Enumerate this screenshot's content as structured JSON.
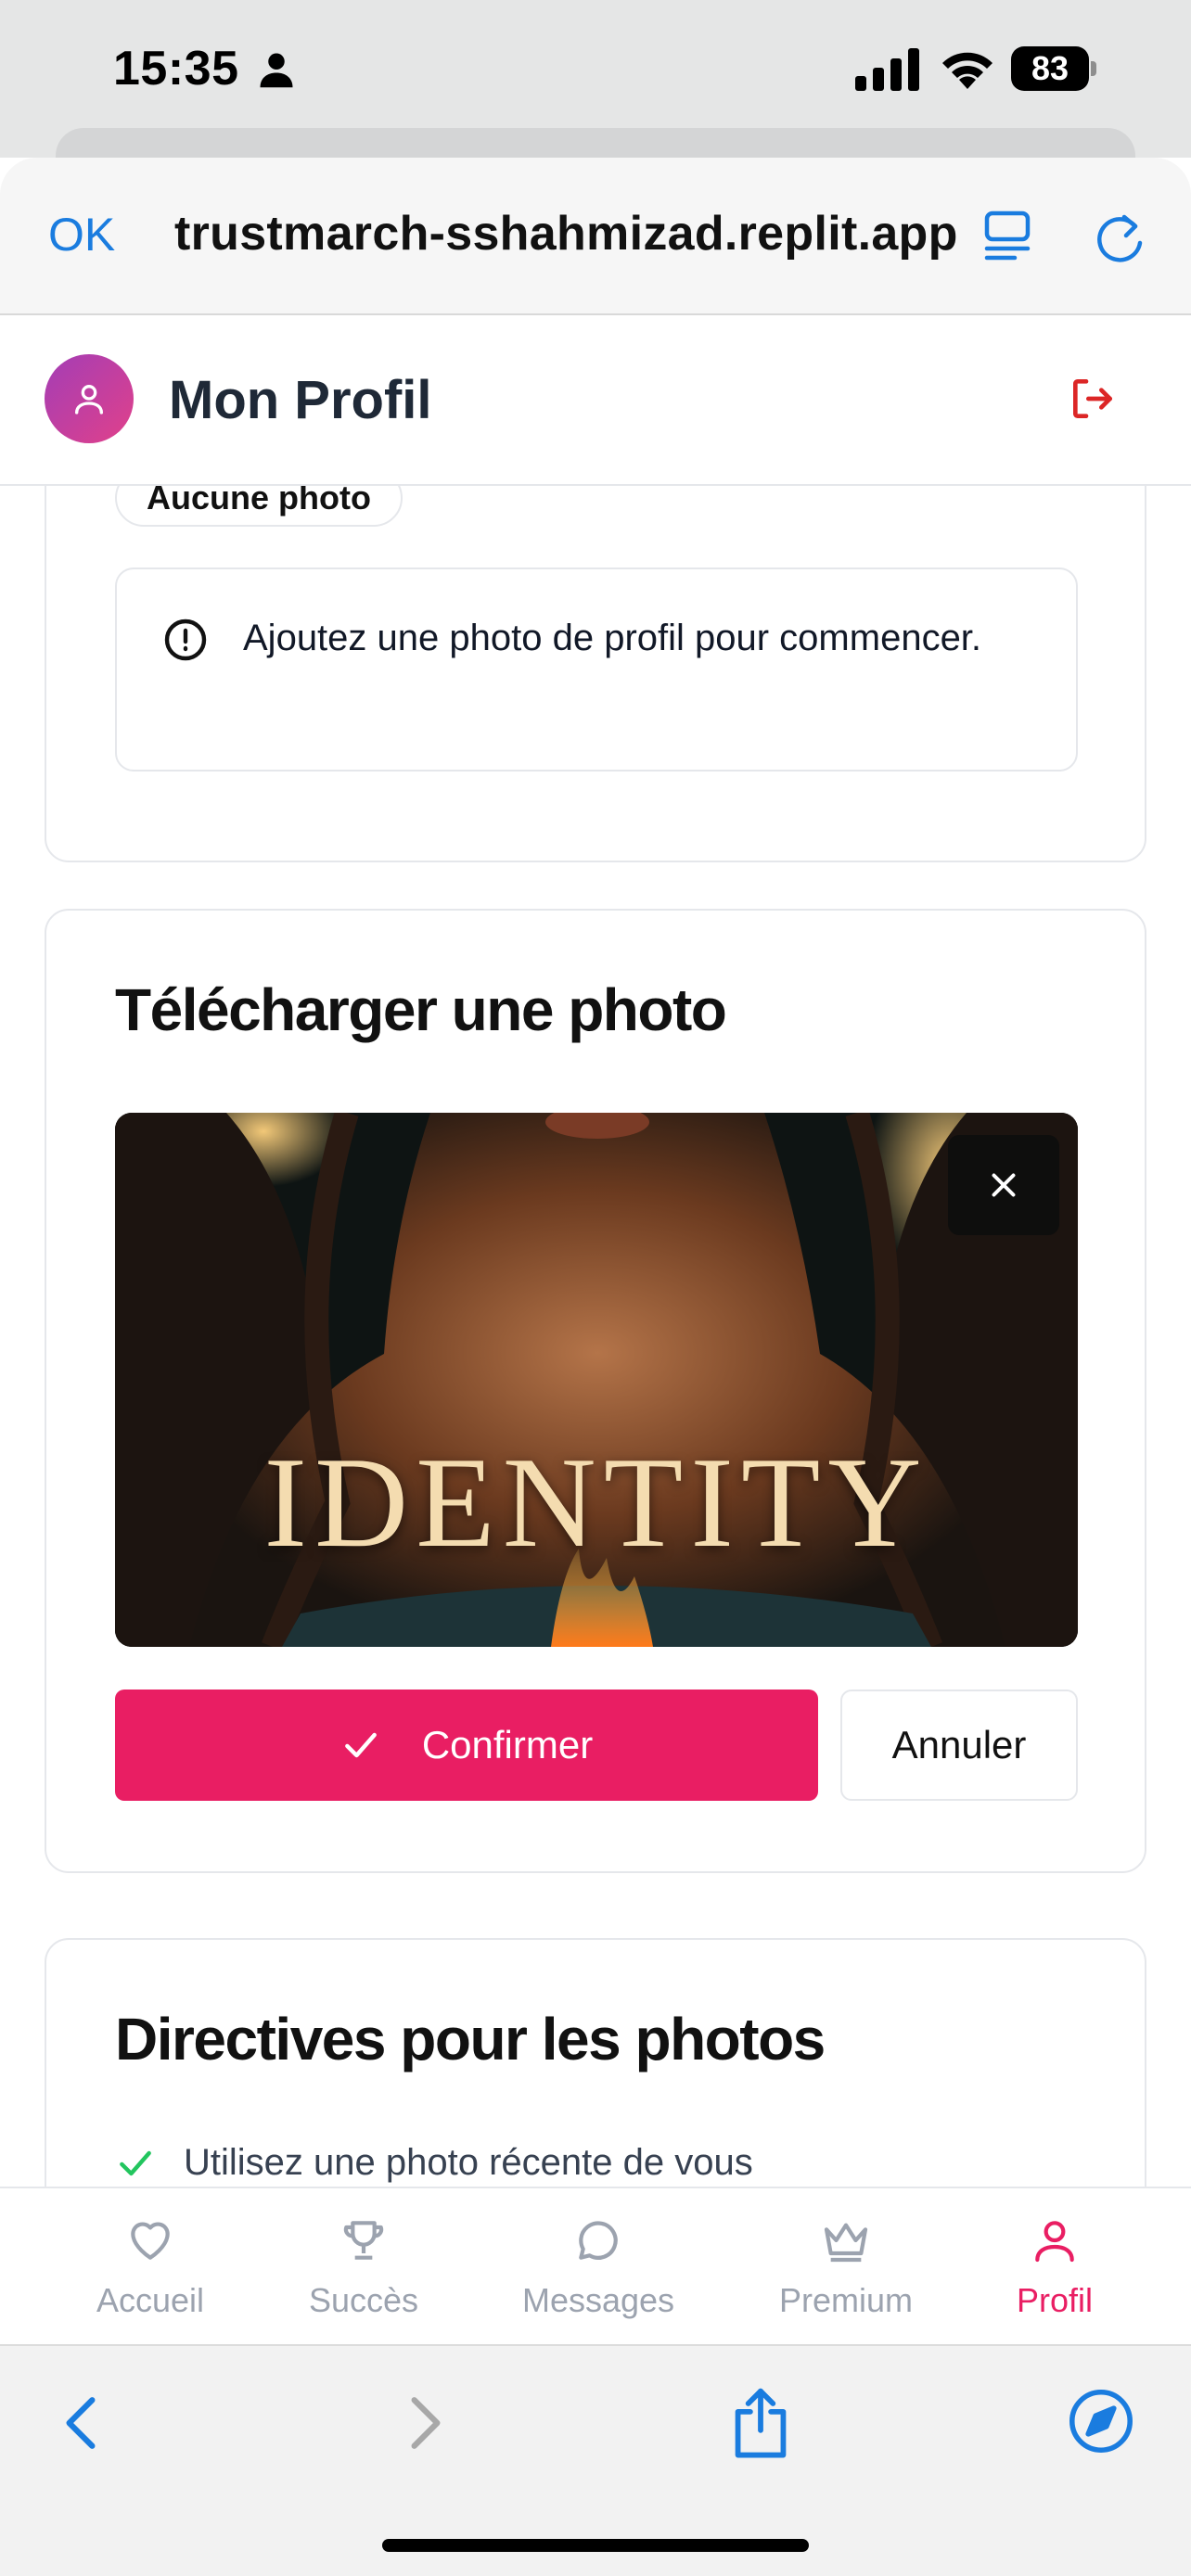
{
  "status_bar": {
    "time": "15:35",
    "battery": "83"
  },
  "browser": {
    "done_label": "OK",
    "url": "trustmarch-sshahmizad.replit.app",
    "accent_color": "#1a7cdf"
  },
  "header": {
    "title": "Mon Profil"
  },
  "profile_status": {
    "badge": "Aucune photo",
    "alert_text": "Ajoutez une photo de profil pour commencer."
  },
  "upload": {
    "title": "Télécharger une photo",
    "preview_text": "IDENTITY",
    "confirm_label": "Confirmer",
    "cancel_label": "Annuler",
    "primary_color": "#e91e63"
  },
  "guidelines": {
    "title": "Directives pour les photos",
    "items": [
      "Utilisez une photo récente de vous"
    ]
  },
  "bottom_nav": {
    "items": [
      {
        "label": "Accueil",
        "icon": "heart-icon"
      },
      {
        "label": "Succès",
        "icon": "trophy-icon"
      },
      {
        "label": "Messages",
        "icon": "message-icon"
      },
      {
        "label": "Premium",
        "icon": "crown-icon"
      },
      {
        "label": "Profil",
        "icon": "user-icon"
      }
    ],
    "active": "Profil"
  }
}
